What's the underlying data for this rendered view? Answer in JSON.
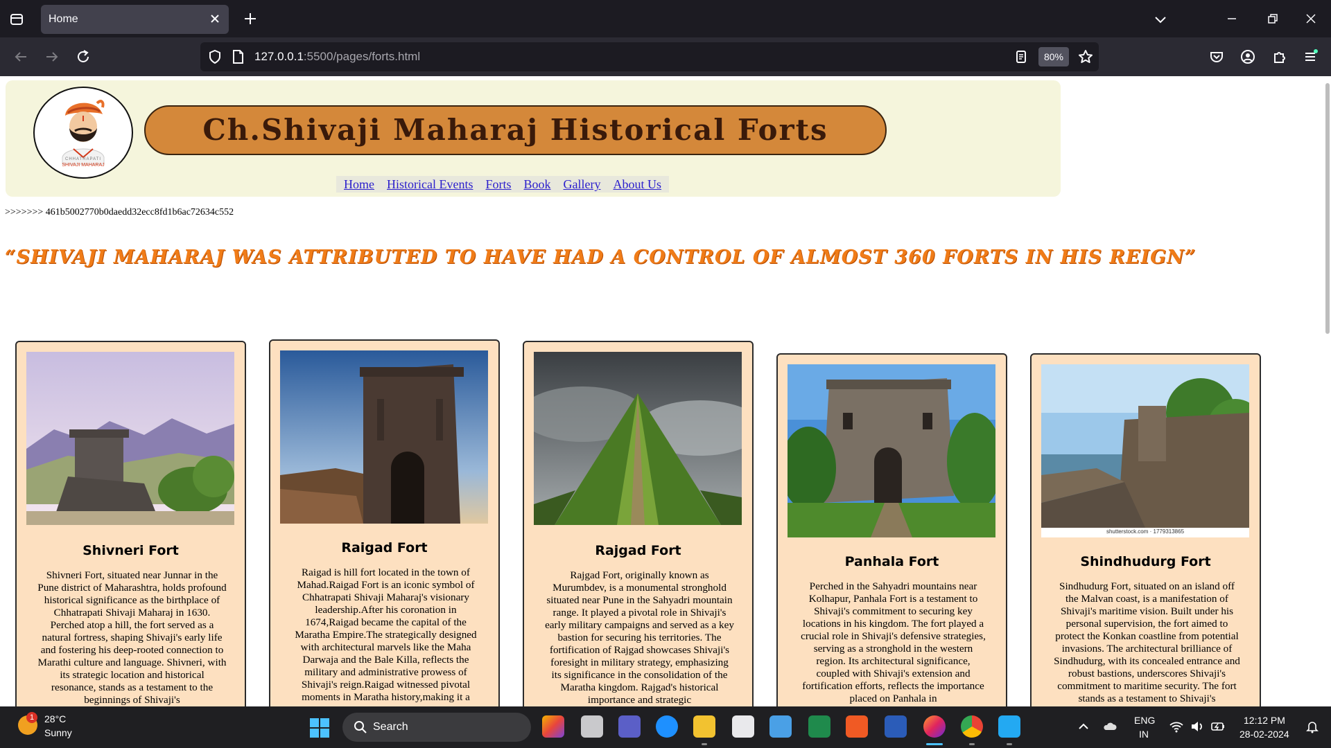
{
  "browser": {
    "tab_title": "Home",
    "url_host": "127.0.0.1",
    "url_rest": ":5500/pages/forts.html",
    "zoom": "80%"
  },
  "page": {
    "site_title": "Ch.Shivaji Maharaj Historical Forts",
    "logo_caption_line1": "CHHATRAPATI",
    "logo_caption_line2": "SHIVAJI MAHARAJ",
    "menu": [
      "Home",
      "Historical Events",
      "Forts",
      "Book",
      "Gallery",
      "About Us"
    ],
    "hash_line": ">>>>>>> 461b5002770b0daedd32ecc8fd1b6ac72634c552",
    "quote": "“Shivaji Maharaj was attributed to have had a control of almost 360 forts in his reign”",
    "forts": [
      {
        "name": "Shivneri Fort",
        "description": "Shivneri Fort, situated near Junnar in the Pune district of Maharashtra, holds profound historical significance as the birthplace of Chhatrapati Shivaji Maharaj in 1630. Perched atop a hill, the fort served as a natural fortress, shaping Shivaji's early life and fostering his deep-rooted connection to Marathi culture and language. Shivneri, with its strategic location and historical resonance, stands as a testament to the beginnings of Shivaji's"
      },
      {
        "name": "Raigad Fort",
        "description": "Raigad is hill fort located in the town of Mahad.Raigad Fort is an iconic symbol of Chhatrapati Shivaji Maharaj's visionary leadership.After his coronation in 1674,Raigad became the capital of the Maratha Empire.The strategically designed with architectural marvels like the Maha Darwaja and the Bale Killa, reflects the military and administrative prowess of Shivaji's reign.Raigad witnessed pivotal moments in Maratha history,making it a"
      },
      {
        "name": "Rajgad Fort",
        "description": "Rajgad Fort, originally known as Murumbdev, is a monumental stronghold situated near Pune in the Sahyadri mountain range. It played a pivotal role in Shivaji's early military campaigns and served as a key bastion for securing his territories. The fortification of Rajgad showcases Shivaji's foresight in military strategy, emphasizing its significance in the consolidation of the Maratha kingdom. Rajgad's historical importance and strategic"
      },
      {
        "name": "Panhala Fort",
        "description": "Perched in the Sahyadri mountains near Kolhapur, Panhala Fort is a testament to Shivaji's commitment to securing key locations in his kingdom. The fort played a crucial role in Shivaji's defensive strategies, serving as a stronghold in the western region. Its architectural significance, coupled with Shivaji's extension and fortification efforts, reflects the importance placed on Panhala in"
      },
      {
        "name": "Shindhudurg Fort",
        "description": "Sindhudurg Fort, situated on an island off the Malvan coast, is a manifestation of Shivaji's maritime vision. Built under his personal supervision, the fort aimed to protect the Konkan coastline from potential invasions. The architectural brilliance of Sindhudurg, with its concealed entrance and robust bastions, underscores Shivaji's commitment to maritime security. The fort stands as a testament to Shivaji's",
        "image_watermark": "shutterstock.com · 1779313865"
      }
    ]
  },
  "taskbar": {
    "weather_temp": "28°C",
    "weather_condition": "Sunny",
    "weather_badge": "1",
    "search_label": "Search",
    "lang_line1": "ENG",
    "lang_line2": "IN",
    "time": "12:12 PM",
    "date": "28-02-2024"
  }
}
